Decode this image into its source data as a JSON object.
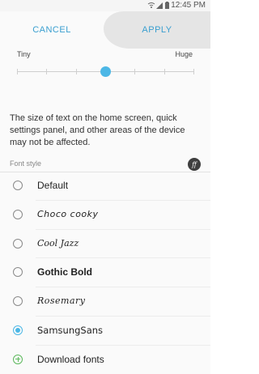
{
  "status_bar": {
    "time": "12:45 PM",
    "icons": [
      "wifi-icon",
      "signal-icon",
      "battery-icon"
    ]
  },
  "action_bar": {
    "cancel_label": "CANCEL",
    "apply_label": "APPLY"
  },
  "font_size": {
    "min_label": "Tiny",
    "max_label": "Huge",
    "steps": 7,
    "selected_step": 3
  },
  "description": "The size of text on the home screen, quick settings panel, and other areas of the device may not be affected.",
  "font_style": {
    "title": "Font style",
    "icon": "font-ff-icon",
    "options": [
      {
        "label": "Default",
        "selected": false
      },
      {
        "label": "Choco cooky",
        "selected": false
      },
      {
        "label": "Cool Jazz",
        "selected": false
      },
      {
        "label": "Gothic Bold",
        "selected": false
      },
      {
        "label": "Rosemary",
        "selected": false
      },
      {
        "label": "SamsungSans",
        "selected": true
      }
    ],
    "download_label": "Download fonts"
  },
  "colors": {
    "accent": "#4cb7e6",
    "button_text": "#3a9fd0",
    "add_icon": "#5cb85c"
  }
}
